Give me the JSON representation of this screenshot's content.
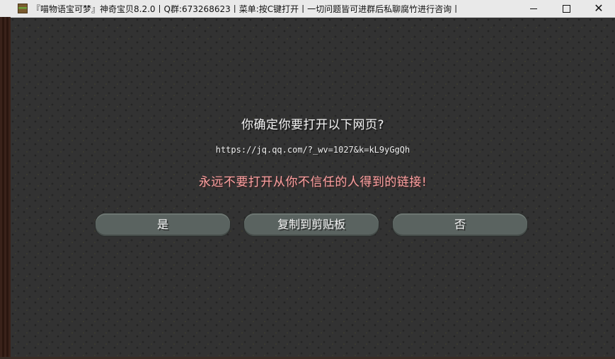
{
  "window": {
    "title": "『喵物语宝可梦』神奇宝贝8.2.0丨Q群:673268623丨菜单:按C键打开丨一切问题皆可进群后私聊腐竹进行咨询丨",
    "icon": "minecraft-grass-block-icon",
    "controls": {
      "minimize": "minimize-icon",
      "maximize": "maximize-icon",
      "close": "✕"
    }
  },
  "dialog": {
    "prompt": "你确定你要打开以下网页?",
    "url": "https://jq.qq.com/?_wv=1027&k=kL9yGgQh",
    "warning": "永远不要打开从你不信任的人得到的链接!",
    "buttons": {
      "yes": "是",
      "copy": "复制到剪贴板",
      "no": "否"
    }
  },
  "colors": {
    "background": "#323232",
    "warning_text": "#ff9f9f",
    "button": "#5a6360",
    "title_bar": "#e9e9e9"
  }
}
